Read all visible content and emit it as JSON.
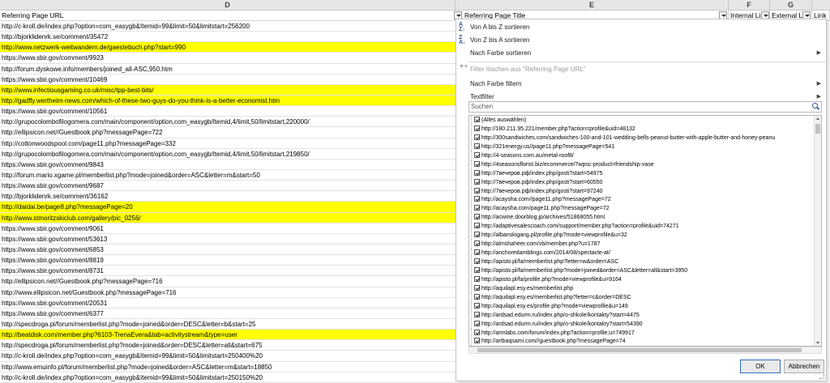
{
  "columns": {
    "letters": [
      "D",
      "E",
      "F",
      "G"
    ],
    "headers": [
      "Referring Page URL",
      "Referring Page Title",
      "Internal Li",
      "External Li",
      "Link"
    ]
  },
  "rows": [
    {
      "url": "http://c-kroll.de/index.php?option=com_easygb&Itemid=99&limit=50&limitstart=256200",
      "hl": false
    },
    {
      "url": "http://bjorklidenrk.se/comment/35472",
      "hl": false
    },
    {
      "url": "http://www.netzwerk-weitwandern.de/gaestebuch.php?start=990",
      "hl": true
    },
    {
      "url": "https://www.sbir.gov/comment/9923",
      "hl": false
    },
    {
      "url": "http://forum.dyskowe.info/members/joined_all-ASC,950.htm",
      "hl": false
    },
    {
      "url": "https://www.sbir.gov/comment/10469",
      "hl": false
    },
    {
      "url": "http://www.infectiousgaming.co.uk/misc/tpp-best-bits/",
      "hl": true
    },
    {
      "url": "http://gadfly.wertheim-news.com/which-of-these-two-guys-do-you-think-is-a-better-economist.htm",
      "hl": true
    },
    {
      "url": "https://www.sbir.gov/comment/10561",
      "hl": false
    },
    {
      "url": "http://grupocolombofilogomera.com/main/component/option,com_easygb/Itemid,4/limit,50/limitstart,220000/",
      "hl": false
    },
    {
      "url": "http://ellipsicon.net//Guestbook.php?messagePage=722",
      "hl": false
    },
    {
      "url": "http://cottonwoodspool.com/page11.php?messagePage=332",
      "hl": false
    },
    {
      "url": "http://grupocolombofilogomera.com/main/component/option,com_easygb/Itemid,4/limit,50/limitstart,219850/",
      "hl": false
    },
    {
      "url": "https://www.sbir.gov/comment/9843",
      "hl": false
    },
    {
      "url": "http://forum.mario.xgame.pl/memberlist.php?mode=joined&order=ASC&letter=m&start=50",
      "hl": false
    },
    {
      "url": "https://www.sbir.gov/comment/9687",
      "hl": false
    },
    {
      "url": "http://bjorklidenrk.se/comment/36162",
      "hl": false
    },
    {
      "url": "http://daidai.be/page8.php?messagePage=20",
      "hl": true
    },
    {
      "url": "http://www.stmoritzskiclub.com/gallery/pic_0256/",
      "hl": true
    },
    {
      "url": "https://www.sbir.gov/comment/9061",
      "hl": false
    },
    {
      "url": "https://www.sbir.gov/comment/53613",
      "hl": false
    },
    {
      "url": "https://www.sbir.gov/comment/6853",
      "hl": false
    },
    {
      "url": "https://www.sbir.gov/comment/8819",
      "hl": false
    },
    {
      "url": "https://www.sbir.gov/comment/8731",
      "hl": false
    },
    {
      "url": "http://ellipsicon.net//Guestbook.php?messagePage=716",
      "hl": false
    },
    {
      "url": "http://www.ellipsicon.net/Guestbook.php?messagePage=716",
      "hl": false
    },
    {
      "url": "https://www.sbir.gov/comment/20531",
      "hl": false
    },
    {
      "url": "https://www.sbir.gov/comment/6377",
      "hl": false
    },
    {
      "url": "http://specdroga.pl/forum/memberlist.php?mode=joined&order=DESC&letter=b&start=25",
      "hl": false
    },
    {
      "url": "http://beatdisk.com/member.php?6103-TrenaEvera&tab=activitystream&type=user",
      "hl": true
    },
    {
      "url": "http://specdroga.pl/forum/memberlist.php?mode=joined&order=DESC&letter=all&start=675",
      "hl": false
    },
    {
      "url": "http://c-kroll.de/index.php?option=com_easygb&Itemid=99&limit=50&limitstart=250400%20",
      "hl": false
    },
    {
      "url": "http://www.emuinfo.pl/forum/memberlist.php?mode=joined&order=ASC&letter=m&start=18850",
      "hl": false
    },
    {
      "url": "http://c-kroll.de/index.php?option=com_easygb&Itemid=99&limit=50&limitstart=250150%20",
      "hl": false
    }
  ],
  "menu": {
    "sort_az": "Von A bis Z sortieren",
    "sort_za": "Von Z bis A sortieren",
    "sort_color": "Nach Farbe sortieren",
    "clear_filter": "Filter löschen aus \"Referring Page URL\"",
    "filter_color": "Nach Farbe filtern",
    "text_filter": "Textfilter",
    "search_placeholder": "Suchen",
    "ok": "OK",
    "cancel": "Abbrechen"
  },
  "filter_items": [
    "(Alles auswählen)",
    "http://180.211.95.221/member.php?action=profile&uid=48132",
    "http://300sandwiches.com/sandwiches-100-and-101-wedding-bells-peanut-butter-with-apple-butter-and-honey-peanu",
    "http://321energy.us//page11.php?messagePage=541",
    "http://4-seasons.com.au/metal-roof8/",
    "http://4seasonsflorist.biz/ecommerce/?wpsc-product=friendship-vase",
    "http://7вечеров.рф/index.php/gosti?start=54975",
    "http://7вечеров.рф/index.php/gosti?start=60550",
    "http://7вечеров.рф/index.php/gosti?start=97240",
    "http://acaysha.com//page11.php?messagePage=72",
    "http://acaysha.com/page11.php?messagePage=72",
    "http://acwine.doorblog.jp/archives/51868055.html",
    "http://adaptivesalescoach.com/support/member.php?action=profile&uid=74271",
    "http://albanskigang.pl/profile.php?mode=viewprofile&u=32",
    "http://almshaheer.com/vb/member.php?u=1787",
    "http://anchoredamblings.com/2014/08/spectacle-at/",
    "http://apisto.pl/fa/memberlist.php?letter=w&order=ASC",
    "http://apisto.pl/fa/memberlist.php?mode=joined&order=ASC&letter=all&start=3950",
    "http://apisto.pl/fa/profile.php?mode=viewprofile&u=9164",
    "http://aquilapl.esy.es/memberlist.php",
    "http://aquilapl.esy.es/memberlist.php?letter=c&order=DESC",
    "http://aquilapl.esy.es/profile.php?mode=viewprofile&u=149",
    "http://ardsad.edurm.ru/index.php/o-shkole/kontakty?start=4475",
    "http://ardsad.edurm.ru/index.php/o-shkole/kontakty?start=54390",
    "http://armlabs.com/forum/index.php?action=profile;u=749917",
    "http://artbaqsami.com//guestbook.php?messagePage=74",
    "http://asalif.se/dagen"
  ],
  "colors": {
    "highlight": "#ffff00",
    "accent": "#2f5597"
  }
}
